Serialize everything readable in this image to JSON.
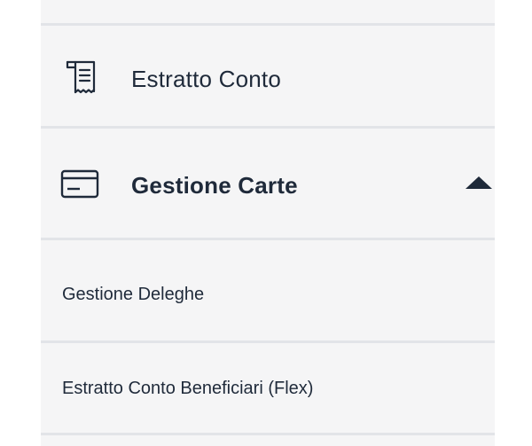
{
  "menu": {
    "items": [
      {
        "label": "Estratto Conto",
        "icon": "document-icon",
        "expanded": false
      },
      {
        "label": "Gestione Carte",
        "icon": "credit-card-icon",
        "expanded": true,
        "toggle_icon": "caret-up-icon",
        "submenu": [
          {
            "label": "Gestione Deleghe"
          },
          {
            "label": "Estratto Conto Beneficiari (Flex)"
          }
        ]
      }
    ]
  },
  "colors": {
    "panel_background": "#f5f5f6",
    "divider": "#e2e4e8",
    "text": "#1f2a3a"
  }
}
